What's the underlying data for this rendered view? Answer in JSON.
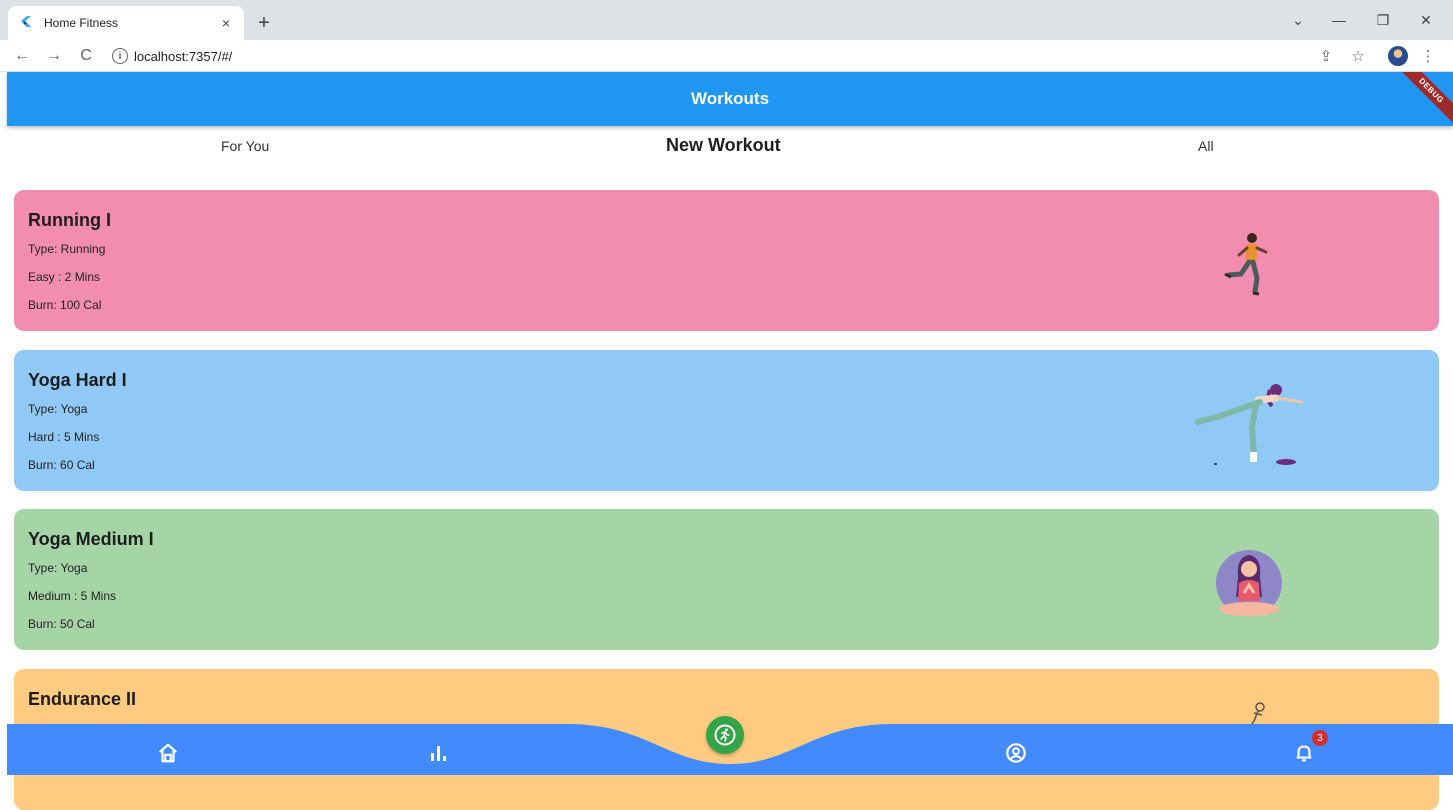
{
  "browser": {
    "tab_title": "Home Fitness",
    "tab_close": "×",
    "new_tab": "+",
    "url": "localhost:7357/#/",
    "info": "i",
    "minimize": "—",
    "restore": "❐",
    "close": "✕",
    "menu_down": "⌄",
    "back": "←",
    "forward": "→",
    "reload": "C",
    "share": "⇪",
    "star": "☆",
    "more": "⋮"
  },
  "app": {
    "title": "Workouts",
    "debug_label": "DEBUG",
    "tabs": [
      {
        "label": "For You",
        "active": false
      },
      {
        "label": "New Workout",
        "active": true
      },
      {
        "label": "All",
        "active": false
      }
    ],
    "workouts": [
      {
        "title": "Running I",
        "type": "Type: Running",
        "level": "Easy : 2 Mins",
        "burn": "Burn: 100 Cal",
        "color": "#f28db0",
        "icon": "runner-illustration"
      },
      {
        "title": "Yoga Hard I",
        "type": "Type: Yoga",
        "level": "Hard : 5 Mins",
        "burn": "Burn: 60 Cal",
        "color": "#90c9f5",
        "icon": "yoga-balance-illustration"
      },
      {
        "title": "Yoga Medium I",
        "type": "Type: Yoga",
        "level": "Medium : 5 Mins",
        "burn": "Burn: 50 Cal",
        "color": "#a5d5a6",
        "icon": "meditation-illustration"
      },
      {
        "title": "Endurance II",
        "type": "",
        "level": "",
        "burn": "",
        "color": "#ffcb80",
        "icon": "endurance-illustration"
      }
    ],
    "bottom_nav": {
      "bar_color": "#448aff",
      "fab_color": "#33a447",
      "items": [
        "home-icon",
        "stats-icon",
        "workout-fab-icon",
        "profile-icon",
        "notifications-icon"
      ],
      "notification_count": "3"
    }
  }
}
